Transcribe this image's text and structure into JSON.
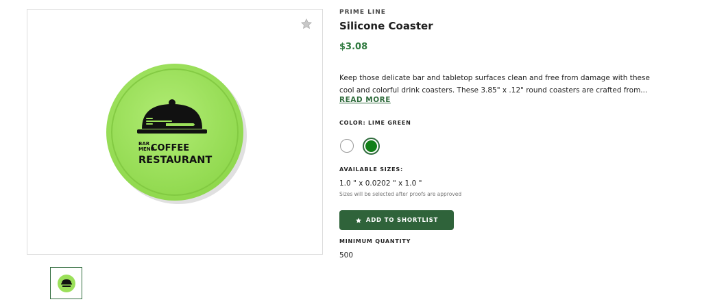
{
  "product": {
    "brand": "PRIME LINE",
    "title": "Silicone Coaster",
    "price": "$3.08",
    "description": "Keep those delicate bar and tabletop surfaces clean and free from damage with these cool and colorful drink coasters. These 3.85\" x .12\" round coasters are crafted from...",
    "read_more": "READ MORE",
    "color_label": "COLOR: LIME GREEN",
    "colors": [
      {
        "name": "white",
        "hex": "#ffffff",
        "selected": false
      },
      {
        "name": "lime-green",
        "hex": "#118018",
        "selected": true
      }
    ],
    "sizes_label": "AVAILABLE SIZES:",
    "sizes_value": "1.0 \" x 0.0202 \" x 1.0 \"",
    "sizes_note": "Sizes will be selected after proofs are approved",
    "shortlist_button": "ADD TO SHORTLIST",
    "min_qty_label": "MINIMUM QUANTITY",
    "min_qty_value": "500"
  },
  "image": {
    "coaster_color": "#9be05a",
    "logo_lines": [
      "BAR",
      "MENU",
      "COFFEE",
      "RESTAURANT"
    ],
    "favorite_icon": "star-icon"
  },
  "colors": {
    "accent": "#2f633a",
    "price": "#2f7a3f"
  }
}
